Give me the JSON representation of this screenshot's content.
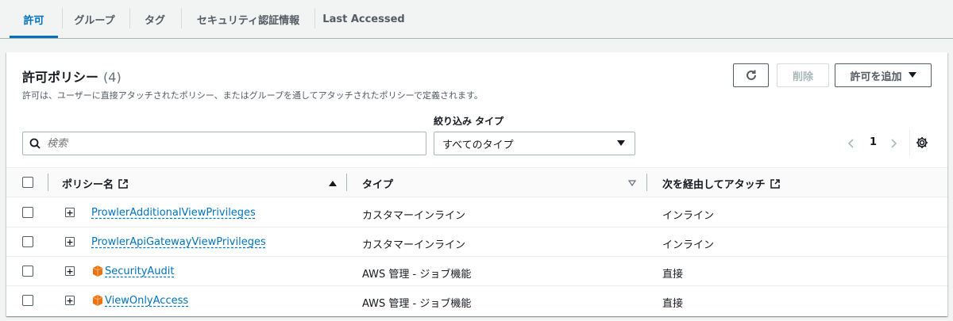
{
  "tabs": [
    {
      "label": "許可",
      "active": true
    },
    {
      "label": "グループ"
    },
    {
      "label": "タグ"
    },
    {
      "label": "セキュリティ認証情報"
    },
    {
      "label": "Last Accessed"
    }
  ],
  "panel": {
    "title": "許可ポリシー",
    "count": "(4)",
    "description": "許可は、ユーザーに直接アタッチされたポリシー、またはグループを通してアタッチされたポリシーで定義されます。",
    "refresh_icon": "refresh-icon",
    "delete_label": "削除",
    "add_label": "許可を追加"
  },
  "filter": {
    "search_placeholder": "検索",
    "type_label": "絞り込み タイプ",
    "type_selected": "すべてのタイプ"
  },
  "pagination": {
    "page": "1"
  },
  "table": {
    "columns": {
      "name": "ポリシー名",
      "type": "タイプ",
      "attached_via": "次を経由してアタッチ"
    },
    "rows": [
      {
        "name": "ProwlerAdditionalViewPrivileges",
        "type": "カスタマーインライン",
        "via": "インライン",
        "aws_managed": false
      },
      {
        "name": "ProwlerApiGatewayViewPrivileges",
        "type": "カスタマーインライン",
        "via": "インライン",
        "aws_managed": false
      },
      {
        "name": "SecurityAudit",
        "type": "AWS 管理 - ジョブ機能",
        "via": "直接",
        "aws_managed": true
      },
      {
        "name": "ViewOnlyAccess",
        "type": "AWS 管理 - ジョブ機能",
        "via": "直接",
        "aws_managed": true
      }
    ]
  },
  "colors": {
    "accent": "#0073bb",
    "aws_orange": "#ec7211"
  }
}
